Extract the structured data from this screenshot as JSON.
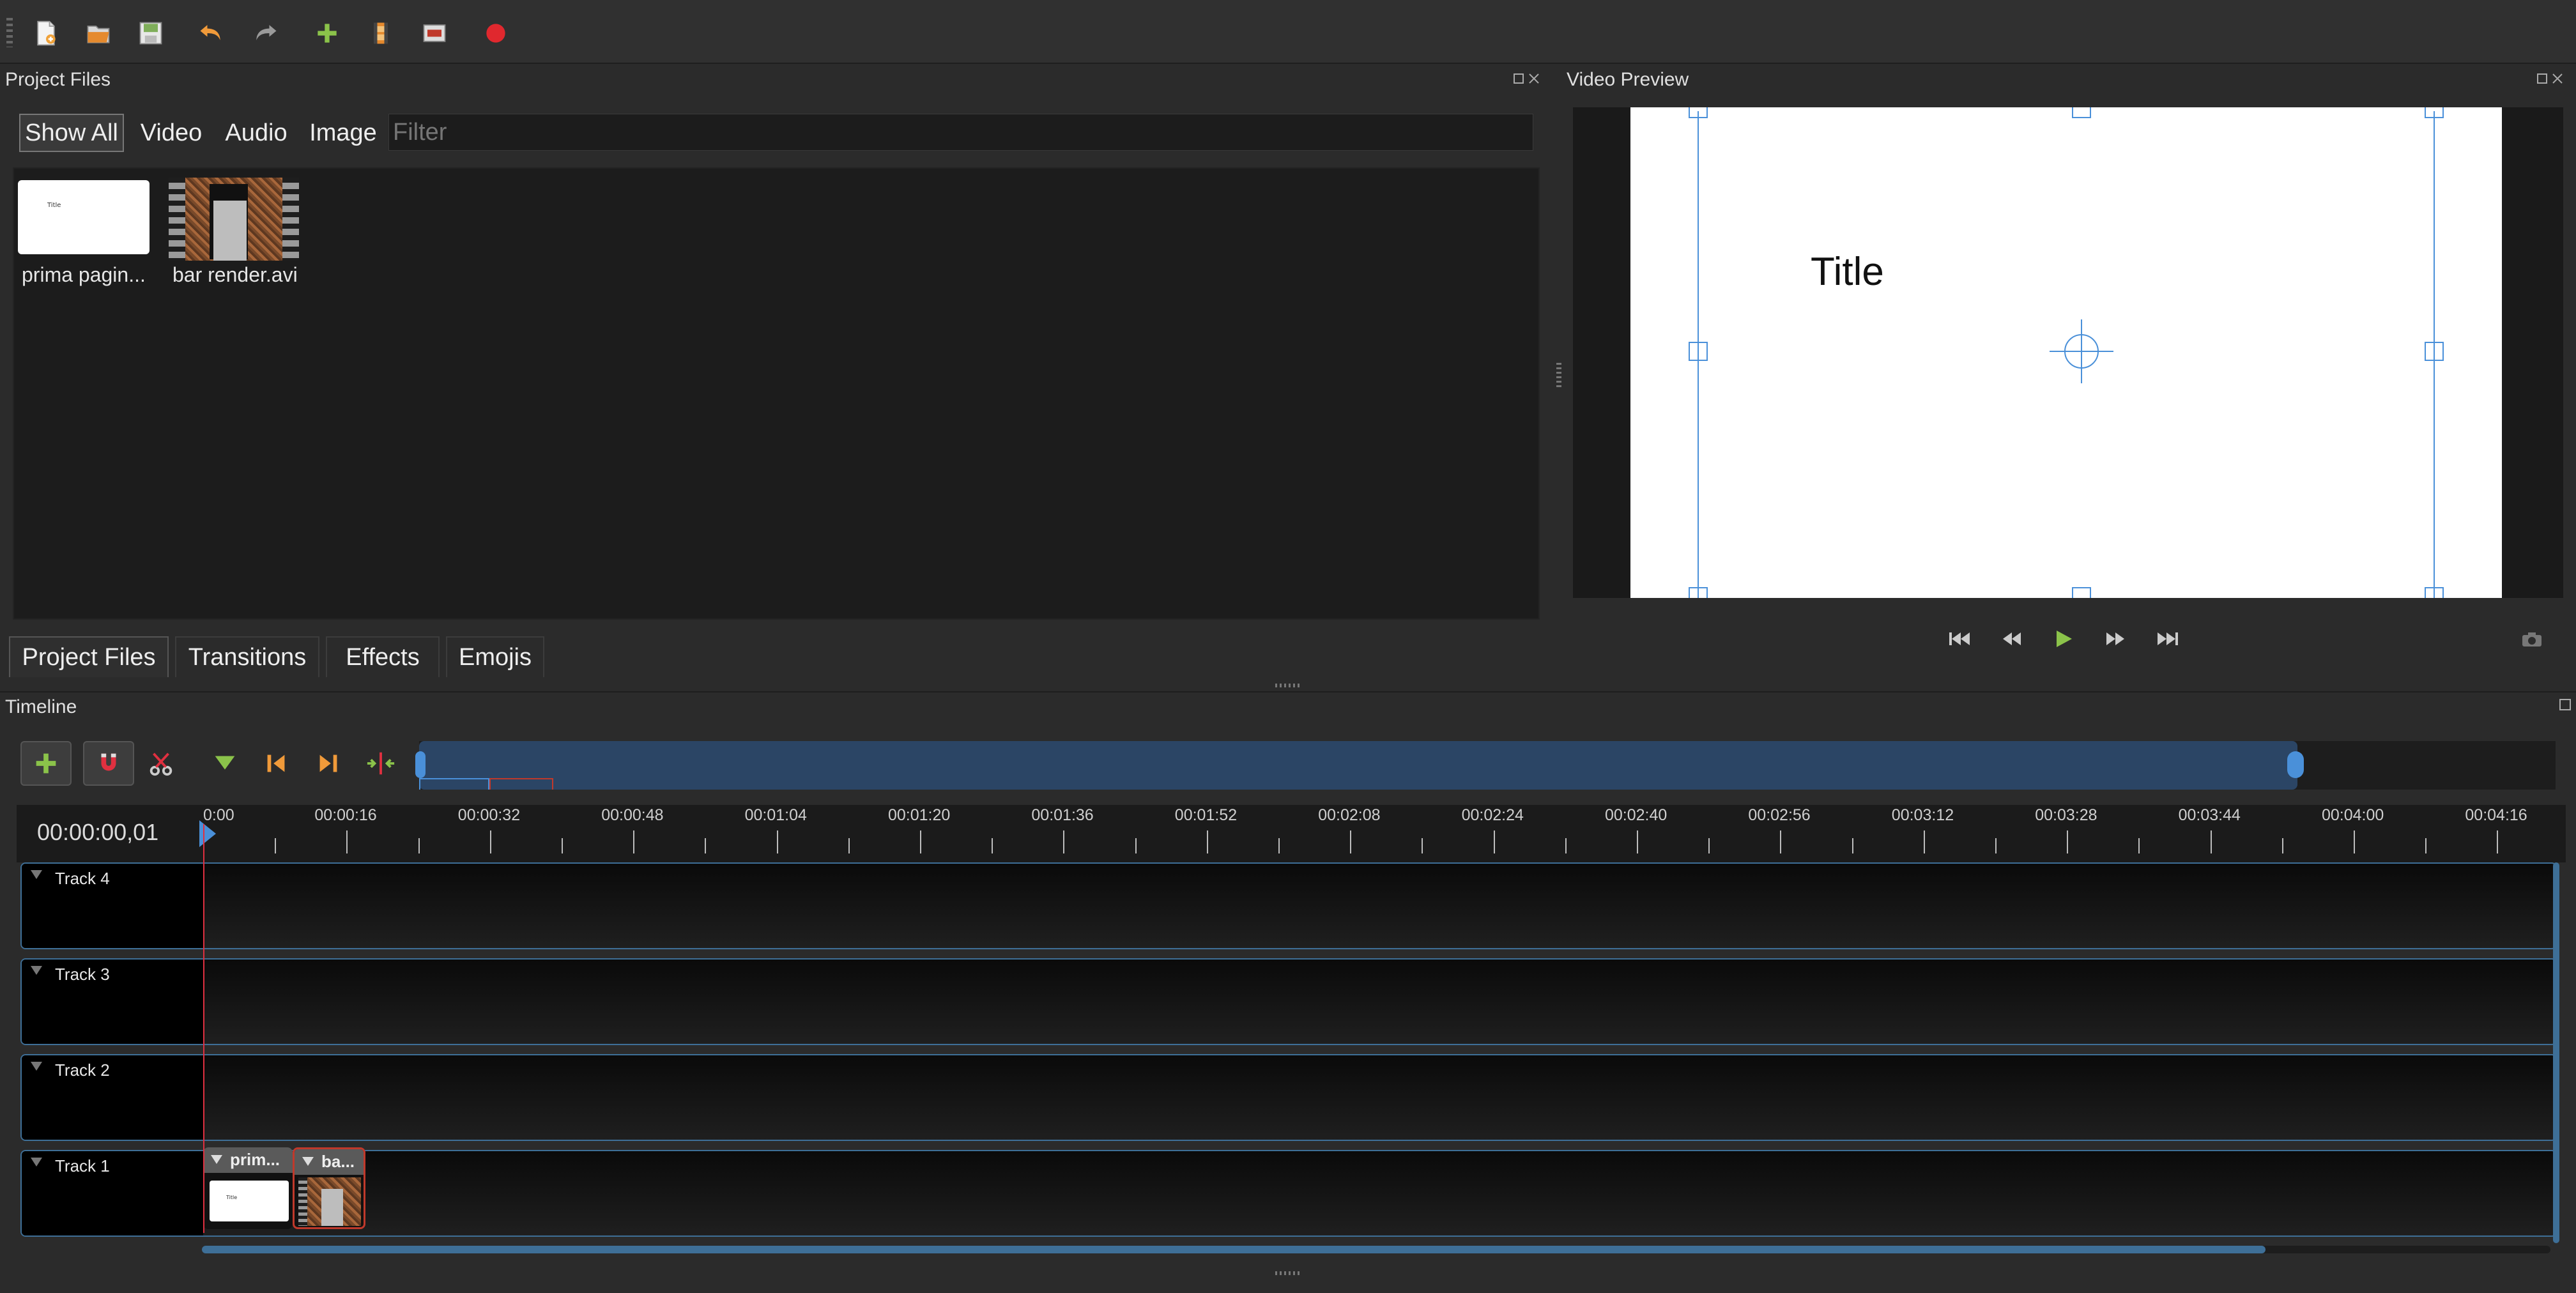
{
  "toolbar": {
    "buttons": [
      {
        "name": "new-project",
        "icon": "new-file-icon"
      },
      {
        "name": "open-project",
        "icon": "open-folder-icon"
      },
      {
        "name": "save-project",
        "icon": "save-icon"
      },
      {
        "name": "undo",
        "icon": "undo-icon"
      },
      {
        "name": "redo",
        "icon": "redo-icon"
      },
      {
        "name": "import-files",
        "icon": "plus-icon"
      },
      {
        "name": "choose-profile",
        "icon": "film-icon"
      },
      {
        "name": "fullscreen",
        "icon": "fullscreen-icon"
      },
      {
        "name": "export-video",
        "icon": "record-icon"
      }
    ]
  },
  "project_files": {
    "title": "Project Files",
    "filter_tabs": [
      "Show All",
      "Video",
      "Audio",
      "Image"
    ],
    "active_filter": "Show All",
    "filter_placeholder": "Filter",
    "files": [
      {
        "label": "prima pagin...",
        "thumb_text": "Title"
      },
      {
        "label": "bar render.avi"
      }
    ]
  },
  "bottom_tabs": [
    "Project Files",
    "Transitions",
    "Effects",
    "Emojis"
  ],
  "video_preview": {
    "title": "Video Preview",
    "title_text": "Title",
    "controls": [
      "jump-start-icon",
      "rewind-icon",
      "play-icon",
      "fast-forward-icon",
      "jump-end-icon"
    ]
  },
  "timeline": {
    "title": "Timeline",
    "timecode": "00:00:00,01",
    "ticks": [
      "0:00",
      "00:00:16",
      "00:00:32",
      "00:00:48",
      "00:01:04",
      "00:01:20",
      "00:01:36",
      "00:01:52",
      "00:02:08",
      "00:02:24",
      "00:02:40",
      "00:02:56",
      "00:03:12",
      "00:03:28",
      "00:03:44",
      "00:04:00",
      "00:04:16"
    ],
    "tracks": [
      "Track 4",
      "Track 3",
      "Track 2",
      "Track 1"
    ],
    "clips": [
      {
        "label": "prim...",
        "thumb_text": "Title"
      },
      {
        "label": "ba..."
      }
    ]
  },
  "colors": {
    "accent": "#3e6f97",
    "playhead": "#e03040",
    "add_green": "#8bc34a"
  }
}
